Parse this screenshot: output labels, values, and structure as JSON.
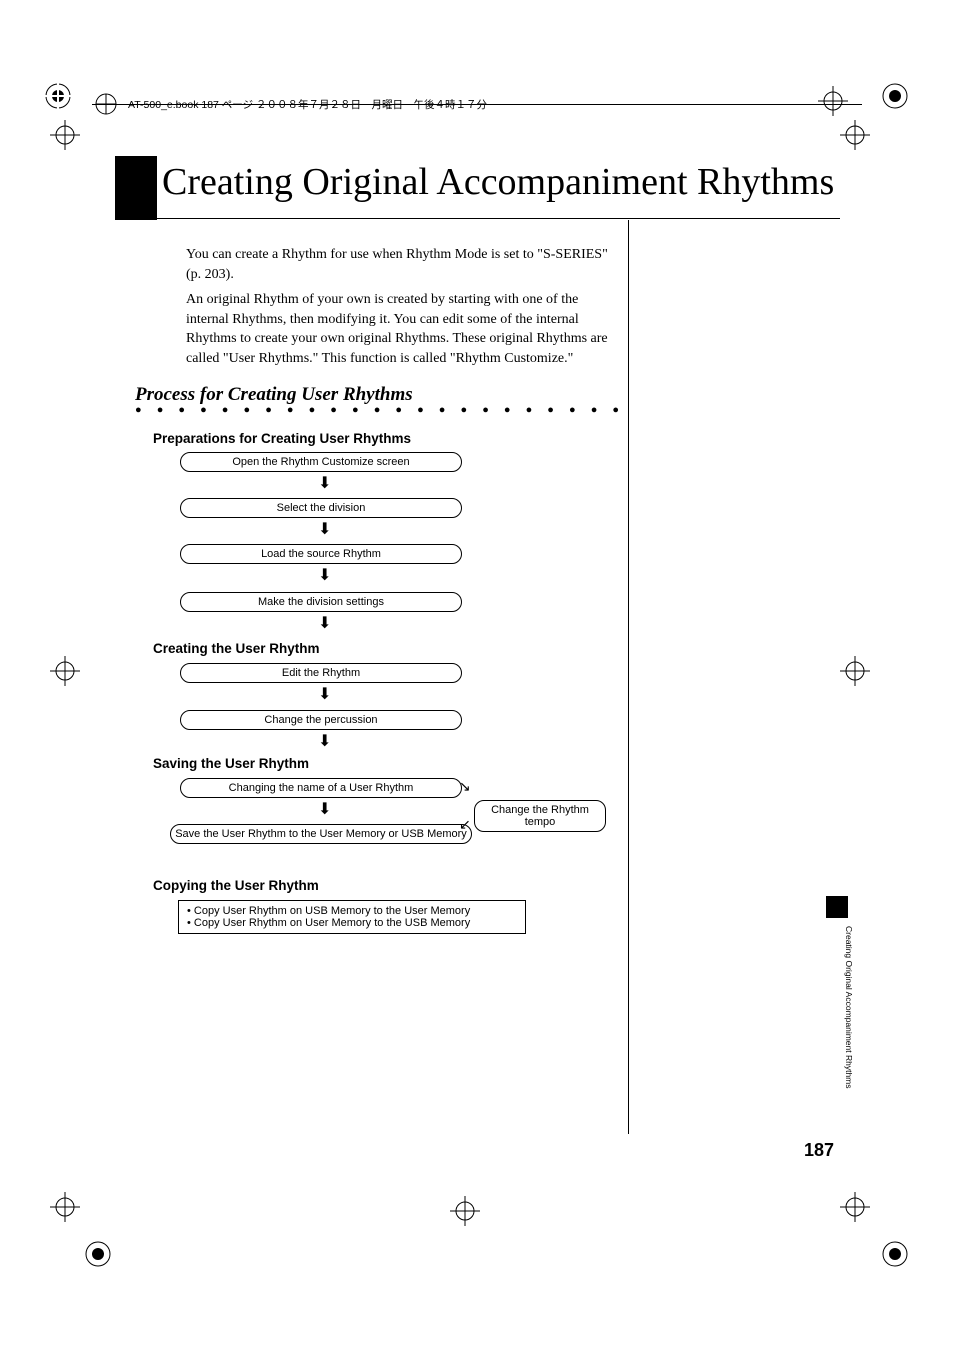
{
  "header": {
    "filename": "AT-500_e.book  187 ページ  ２００８年７月２８日　月曜日　午後４時１７分"
  },
  "title": "Creating Original Accompaniment Rhythms",
  "intro": {
    "p1": "You can create a Rhythm for use when Rhythm Mode is set to \"S-SERIES\" (p. 203).",
    "p2": "An original Rhythm of your own is created by starting with one of the internal Rhythms, then modifying it. You can edit some of the internal Rhythms to create your own original Rhythms. These original Rhythms are called \"User Rhythms.\" This function is called \"Rhythm Customize.\""
  },
  "section_heading": "Process for Creating User Rhythms",
  "groups": {
    "prep": {
      "heading": "Preparations for Creating User Rhythms",
      "steps": [
        "Open the Rhythm Customize screen",
        "Select the division",
        "Load the source Rhythm",
        "Make the division settings"
      ]
    },
    "create": {
      "heading": "Creating the User Rhythm",
      "steps": [
        "Edit the Rhythm",
        "Change the percussion"
      ]
    },
    "save": {
      "heading": "Saving the User Rhythm",
      "steps": [
        "Changing the name of a User Rhythm",
        "Save the User Rhythm to the User Memory or USB Memory"
      ],
      "side": "Change the Rhythm tempo"
    },
    "copy": {
      "heading": "Copying the User Rhythm",
      "items": [
        "• Copy User Rhythm on USB Memory to the User Memory",
        "• Copy User Rhythm on User Memory to the USB Memory"
      ]
    }
  },
  "page_number": "187",
  "side_tab_text": "Creating Original Accompaniment Rhythms"
}
